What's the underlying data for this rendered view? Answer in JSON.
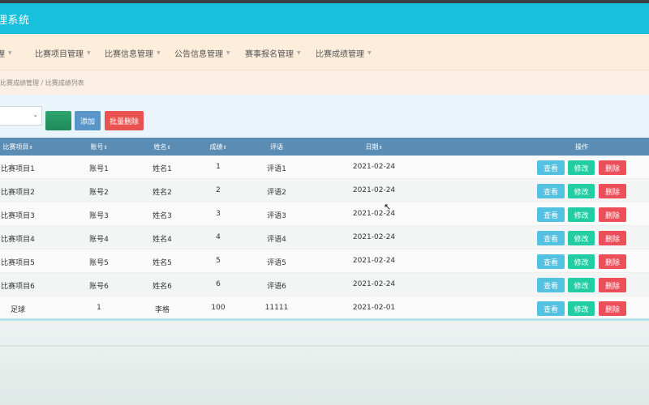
{
  "header": {
    "title": "理系统"
  },
  "nav": {
    "items": [
      {
        "label": "管理"
      },
      {
        "label": "比赛项目管理"
      },
      {
        "label": "比赛信息管理"
      },
      {
        "label": "公告信息管理"
      },
      {
        "label": "赛事报名管理"
      },
      {
        "label": "比赛成绩管理"
      }
    ]
  },
  "breadcrumb": {
    "text": "比赛成绩管理 / 比赛成绩列表"
  },
  "toolbar": {
    "add_label": "添加",
    "batch_delete_label": "批量删除"
  },
  "table": {
    "headers": [
      "比赛项目",
      "账号",
      "姓名",
      "成绩",
      "评语",
      "日期",
      "操作"
    ],
    "rows": [
      [
        "比赛项目1",
        "账号1",
        "姓名1",
        "1",
        "评语1",
        "2021-02-24"
      ],
      [
        "比赛项目2",
        "账号2",
        "姓名2",
        "2",
        "评语2",
        "2021-02-24"
      ],
      [
        "比赛项目3",
        "账号3",
        "姓名3",
        "3",
        "评语3",
        "2021-02-24"
      ],
      [
        "比赛项目4",
        "账号4",
        "姓名4",
        "4",
        "评语4",
        "2021-02-24"
      ],
      [
        "比赛项目5",
        "账号5",
        "姓名5",
        "5",
        "评语5",
        "2021-02-24"
      ],
      [
        "比赛项目6",
        "账号6",
        "姓名6",
        "6",
        "评语6",
        "2021-02-24"
      ],
      [
        "足球",
        "1",
        "李格",
        "100",
        "11111",
        "2021-02-01"
      ]
    ],
    "actions": {
      "view": "查看",
      "edit": "修改",
      "delete": "删除"
    }
  },
  "colors": {
    "header_bg": "#17c1de",
    "nav_bg": "#fdeedb",
    "table_head_bg": "#5b8db4",
    "view_btn": "#53c1e0",
    "edit_btn": "#23cda3",
    "delete_btn": "#ec4e5a",
    "batch_delete_btn": "#ea5252",
    "add_btn": "#5a95c7"
  }
}
